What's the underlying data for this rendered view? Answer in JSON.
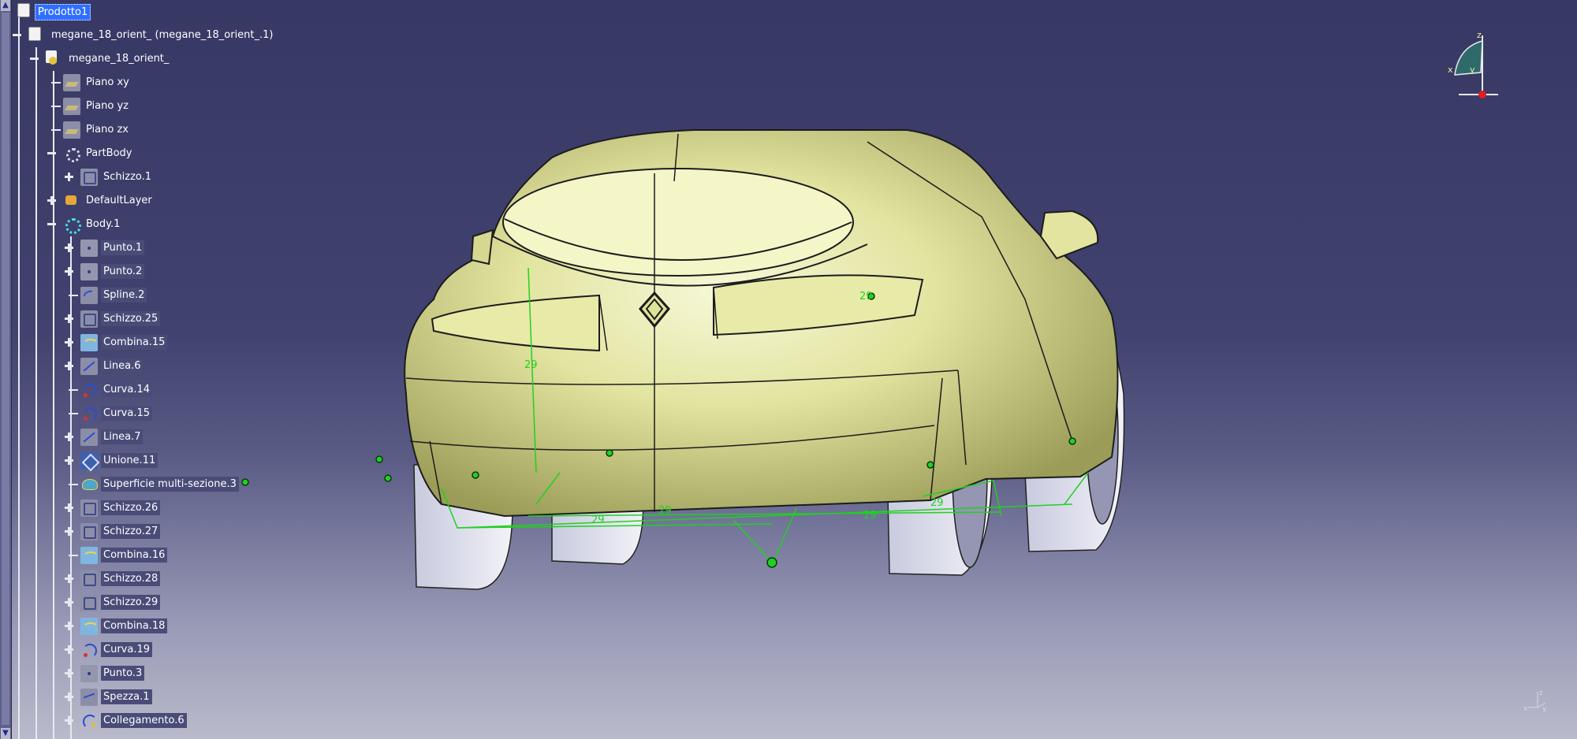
{
  "tree": {
    "root": "Prodotto1",
    "items": [
      {
        "label": "megane_18_orient_ (megane_18_orient_.1)",
        "icon": "product-icon"
      },
      {
        "label": "megane_18_orient_",
        "icon": "part-icon"
      },
      {
        "label": "Piano xy",
        "icon": "plane-icon"
      },
      {
        "label": "Piano yz",
        "icon": "plane-icon"
      },
      {
        "label": "Piano zx",
        "icon": "plane-icon"
      },
      {
        "label": "PartBody",
        "icon": "gear-icon"
      },
      {
        "label": "Schizzo.1",
        "icon": "sketch-icon"
      },
      {
        "label": "DefaultLayer",
        "icon": "layer-icon"
      },
      {
        "label": "Body.1",
        "icon": "body-icon"
      },
      {
        "label": "Punto.1",
        "icon": "point-icon"
      },
      {
        "label": "Punto.2",
        "icon": "point-icon"
      },
      {
        "label": "Spline.2",
        "icon": "spline-icon"
      },
      {
        "label": "Schizzo.25",
        "icon": "sketch-icon"
      },
      {
        "label": "Combina.15",
        "icon": "combine-icon"
      },
      {
        "label": "Linea.6",
        "icon": "line-icon"
      },
      {
        "label": "Curva.14",
        "icon": "curve-icon"
      },
      {
        "label": "Curva.15",
        "icon": "curve-icon"
      },
      {
        "label": "Linea.7",
        "icon": "line-icon"
      },
      {
        "label": "Unione.11",
        "icon": "join-icon"
      },
      {
        "label": "Superficie multi-sezione.3",
        "icon": "multi-section-icon"
      },
      {
        "label": "Schizzo.26",
        "icon": "sketch-icon"
      },
      {
        "label": "Schizzo.27",
        "icon": "sketch-icon"
      },
      {
        "label": "Combina.16",
        "icon": "combine-icon"
      },
      {
        "label": "Schizzo.28",
        "icon": "sketch-icon"
      },
      {
        "label": "Schizzo.29",
        "icon": "sketch-icon"
      },
      {
        "label": "Combina.18",
        "icon": "combine-icon"
      },
      {
        "label": "Curva.19",
        "icon": "curve-icon"
      },
      {
        "label": "Punto.3",
        "icon": "point-icon"
      },
      {
        "label": "Spezza.1",
        "icon": "break-icon"
      },
      {
        "label": "Collegamento.6",
        "icon": "link-icon"
      }
    ]
  },
  "viewport": {
    "dimensions": [
      "29",
      "29",
      "29",
      "29",
      "29",
      "29"
    ]
  },
  "compass": {
    "x": "x",
    "y": "y",
    "z": "z"
  },
  "axis_mini": {
    "x": "x",
    "y": "y",
    "z": "z"
  },
  "colors": {
    "selection": "#2f6fff",
    "body_surface": "#e6e8a8",
    "constraint_green": "#22d022",
    "background_top": "#373864",
    "background_bottom": "#b9bacb"
  }
}
